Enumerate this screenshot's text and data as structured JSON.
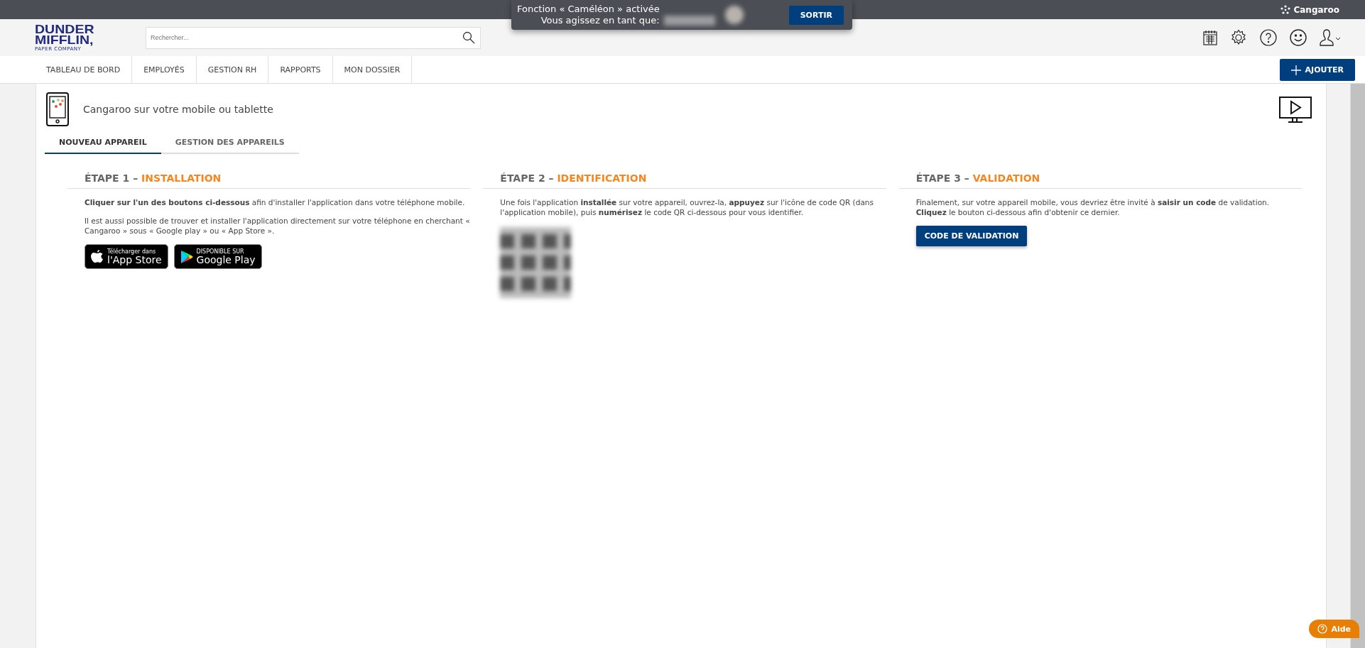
{
  "top_bar": {
    "brand": "Cangaroo"
  },
  "impersonation": {
    "line_1": "Fonction « Caméléon » activée",
    "line_2": "Vous agissez en tant que:",
    "exit_button": "SORTIR"
  },
  "header": {
    "logo": {
      "line_1": "DUNDER",
      "line_2": "MIFFLIN,",
      "tagline": "PAPER COMPANY"
    },
    "search": {
      "placeholder": "Rechercher..."
    }
  },
  "nav": {
    "items": [
      {
        "label": "TABLEAU DE BORD"
      },
      {
        "label": "EMPLOYÉS"
      },
      {
        "label": "GESTION RH"
      },
      {
        "label": "RAPPORTS"
      },
      {
        "label": "MON DOSSIER"
      }
    ],
    "add_button": "AJOUTER"
  },
  "page": {
    "title": "Cangaroo sur votre mobile ou tablette",
    "tabs": [
      {
        "label": "NOUVEAU APPAREIL",
        "selected": true
      },
      {
        "label": "GESTION DES APPAREILS",
        "selected": false
      }
    ],
    "steps": [
      {
        "prefix": "ÉTAPE 1 –",
        "title": "INSTALLATION",
        "paragraphs": [
          "**Cliquer sur l'un des boutons ci-dessous** afin d'installer l'application dans votre téléphone mobile.",
          "Il est aussi possible de trouver et installer l'application directement sur votre téléphone en cherchant « Cangaroo » sous « Google play » ou « App Store »."
        ],
        "kind": "stores",
        "badges": [
          {
            "kind": "apple",
            "small": "Télécharger dans",
            "big": "l'App Store"
          },
          {
            "kind": "google",
            "small": "DISPONIBLE SUR",
            "big": "Google Play"
          }
        ]
      },
      {
        "prefix": "ÉTAPE 2 –",
        "title": "IDENTIFICATION",
        "paragraphs": [
          "Une fois l'application **installée** sur votre appareil, ouvrez-la, **appuyez** sur l'icône de code QR (dans l'application mobile), puis **numérisez** le code QR ci-dessous pour vous identifier."
        ],
        "kind": "qr"
      },
      {
        "prefix": "ÉTAPE 3 –",
        "title": "VALIDATION",
        "paragraphs": [
          "Finalement, sur votre appareil mobile, vous devriez être invité à **saisir un code** de validation.\n**Cliquez** le bouton ci-dessous afin d'obtenir ce dernier."
        ],
        "kind": "button",
        "button": "CODE DE VALIDATION"
      }
    ]
  },
  "help_button": "Aide"
}
